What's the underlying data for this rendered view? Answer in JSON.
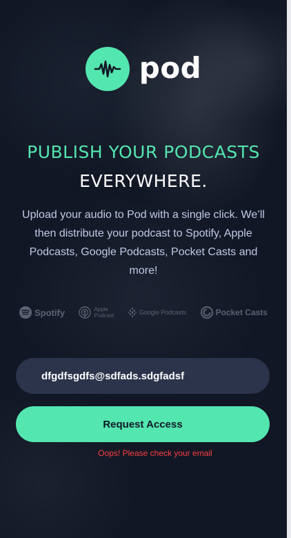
{
  "brand": {
    "name": "pod",
    "accent_color": "#54e6af",
    "background_color": "#121725"
  },
  "hero": {
    "headline_line1": "PUBLISH YOUR PODCASTS",
    "headline_line2": "EVERYWHERE.",
    "description": "Upload your audio to Pod with a single click. We’ll then distribute your podcast to Spotify, Apple Podcasts, Google Podcasts, Pocket Casts and more!"
  },
  "platforms": {
    "spotify": "Spotify",
    "apple_line1": "Apple",
    "apple_line2": "Podcast",
    "google": "Google Podcasts",
    "pocket": "Pocket Casts",
    "icons": [
      "spotify-icon",
      "apple-podcasts-icon",
      "google-podcasts-icon",
      "pocket-casts-icon"
    ]
  },
  "form": {
    "email_value": "dfgdfsgdfs@sdfads.sdgfadsf",
    "button_label": "Request Access",
    "error_message": "Oops! Please check your email",
    "error_color": "#fb3e3e"
  }
}
